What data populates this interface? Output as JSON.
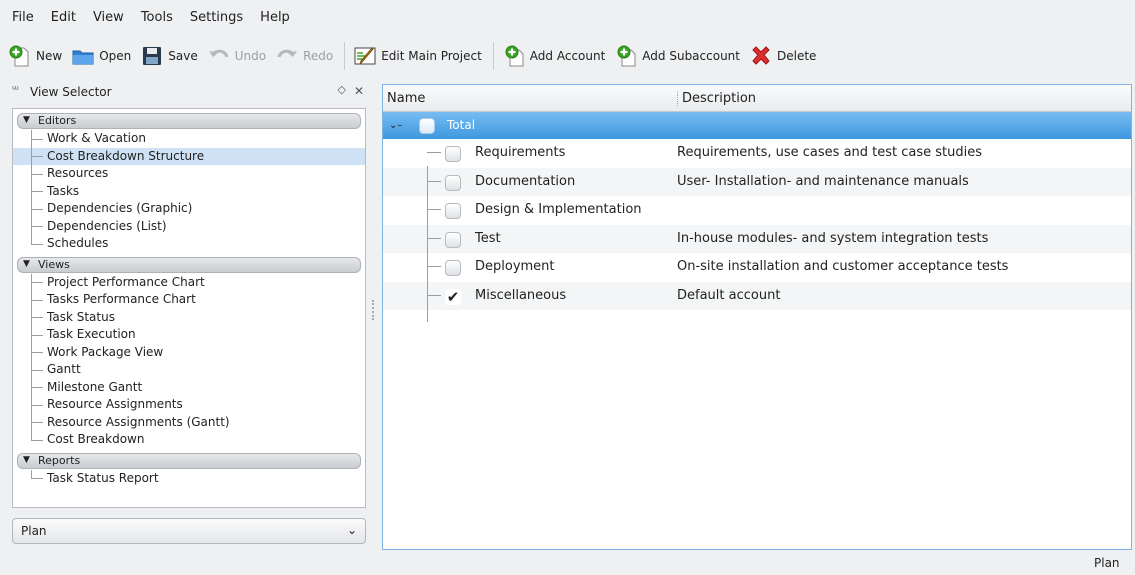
{
  "menu": [
    "File",
    "Edit",
    "View",
    "Tools",
    "Settings",
    "Help"
  ],
  "toolbar": {
    "new": "New",
    "open": "Open",
    "save": "Save",
    "undo": "Undo",
    "redo": "Redo",
    "edit_main_project": "Edit Main Project",
    "add_account": "Add Account",
    "add_subaccount": "Add Subaccount",
    "delete": "Delete"
  },
  "view_selector": {
    "title": "View Selector",
    "groups": [
      {
        "label": "Editors",
        "items": [
          "Work & Vacation",
          "Cost Breakdown Structure",
          "Resources",
          "Tasks",
          "Dependencies (Graphic)",
          "Dependencies (List)",
          "Schedules"
        ]
      },
      {
        "label": "Views",
        "items": [
          "Project Performance Chart",
          "Tasks Performance Chart",
          "Task Status",
          "Task Execution",
          "Work Package View",
          "Gantt",
          "Milestone Gantt",
          "Resource Assignments",
          "Resource Assignments (Gantt)",
          "Cost Breakdown"
        ]
      },
      {
        "label": "Reports",
        "items": [
          "Task Status Report"
        ]
      }
    ],
    "selected": "Cost Breakdown Structure",
    "combo_value": "Plan"
  },
  "table": {
    "columns": [
      "Name",
      "Description"
    ],
    "root": "Total",
    "rows": [
      {
        "name": "Requirements",
        "description": "Requirements, use cases and test case studies",
        "checked": false
      },
      {
        "name": "Documentation",
        "description": "User- Installation- and maintenance manuals",
        "checked": false
      },
      {
        "name": "Design & Implementation",
        "description": "",
        "checked": false
      },
      {
        "name": "Test",
        "description": "In-house modules- and system integration tests",
        "checked": false
      },
      {
        "name": "Deployment",
        "description": "On-site installation and customer acceptance tests",
        "checked": false
      },
      {
        "name": "Miscellaneous",
        "description": "Default account",
        "checked": true
      }
    ]
  },
  "status_text": "Plan",
  "colors": {
    "selection": "#3d98e0",
    "accent_border": "#7fb2e6",
    "selected_item": "#cfe2f5"
  }
}
